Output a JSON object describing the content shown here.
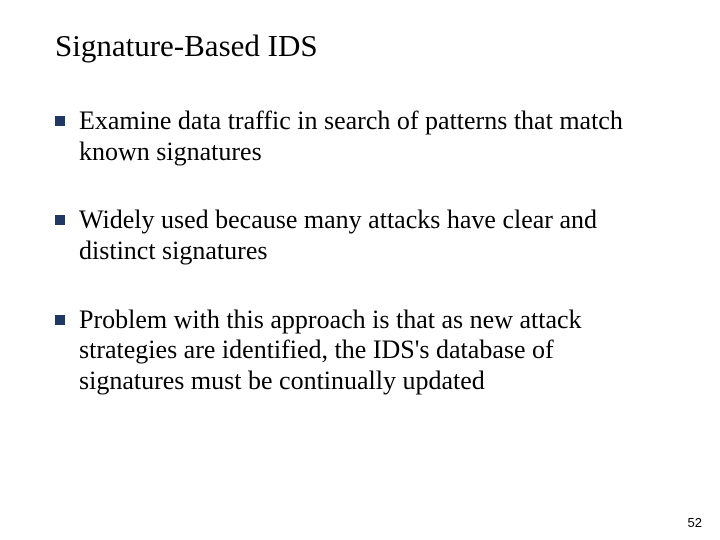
{
  "slide": {
    "title": "Signature-Based IDS",
    "bullets": [
      {
        "text": "Examine data traffic in search of patterns that match known signatures"
      },
      {
        "text": "Widely used because many attacks have clear and distinct signatures"
      },
      {
        "text": "Problem with this approach is that as new attack strategies are identified, the IDS's database of signatures must be continually updated"
      }
    ],
    "pageNumber": "52"
  },
  "colors": {
    "bulletMarker": "#1f3864"
  }
}
